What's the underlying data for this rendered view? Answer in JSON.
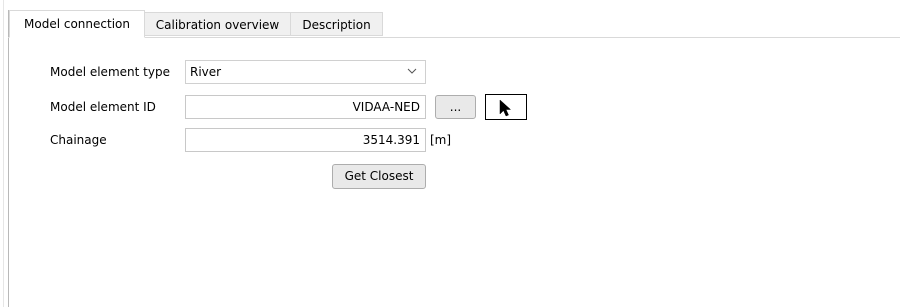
{
  "tabs": [
    {
      "label": "Model connection",
      "active": true
    },
    {
      "label": "Calibration overview",
      "active": false
    },
    {
      "label": "Description",
      "active": false
    }
  ],
  "form": {
    "element_type": {
      "label": "Model element type",
      "value": "River"
    },
    "element_id": {
      "label": "Model element ID",
      "value": "VIDAA-NED",
      "browse_label": "..."
    },
    "chainage": {
      "label": "Chainage",
      "value": "3514.391",
      "unit": "[m]"
    },
    "get_closest_label": "Get Closest"
  },
  "icons": {
    "dropdown": "chevron-down-icon",
    "pick": "mouse-pointer-icon"
  },
  "colors": {
    "tab_border": "#d9d9d9",
    "tab_inactive_bg": "#f0f0f0",
    "button_bg": "#e9e9e9",
    "button_border": "#adadad"
  }
}
